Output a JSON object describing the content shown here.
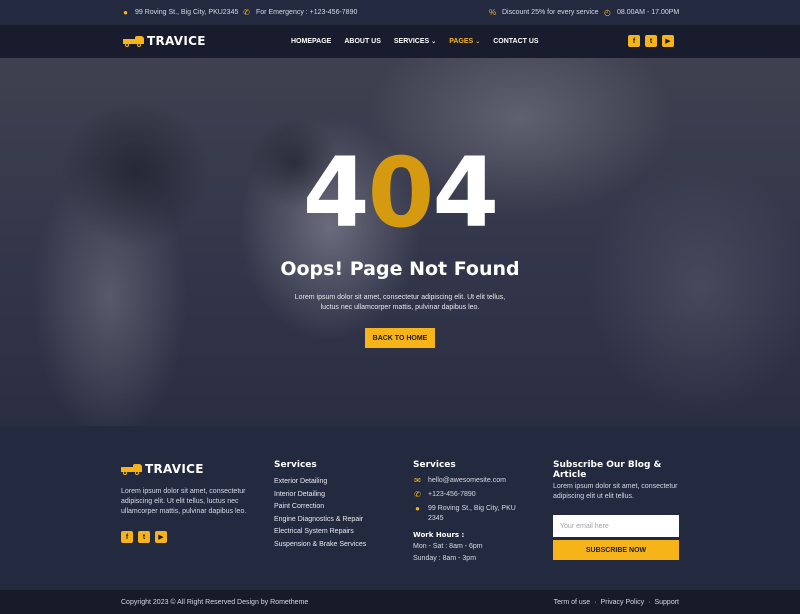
{
  "topbar": {
    "address": "99 Roving St., Big City, PKU2345",
    "emergency": "For Emergency : +123-456-7890",
    "discount": "Discount 25% for every service",
    "hours": "08.00AM - 17.00PM"
  },
  "brand": {
    "name": "TRAVICE",
    "accent": "#f6b418"
  },
  "nav": {
    "items": [
      {
        "label": "HOMEPAGE"
      },
      {
        "label": "ABOUT US"
      },
      {
        "label": "SERVICES"
      },
      {
        "label": "PAGES"
      },
      {
        "label": "CONTACT US"
      }
    ],
    "socials": [
      "facebook-icon",
      "twitter-icon",
      "youtube-icon"
    ]
  },
  "hero": {
    "code_left": "4",
    "code_mid": "0",
    "code_right": "4",
    "title": "Oops! Page Not Found",
    "text": "Lorem ipsum dolor sit amet, consectetur adipiscing elit. Ut elit tellus, luctus nec ullamcorper mattis, pulvinar dapibus leo.",
    "button": "BACK TO HOME"
  },
  "footer": {
    "about": "Lorem ipsum dolor sit amet, consectetur adipiscing elit. Ut elit tellus, luctus nec ullamcorper mattis, pulvinar dapibus leo.",
    "services_heading": "Services",
    "services": [
      "Exterior Detailing",
      "Interior Detailing",
      "Paint Correction",
      "Engine Diagnostics & Repair",
      "Electrical System Repairs",
      "Suspension & Brake Services"
    ],
    "contact_heading": "Services",
    "email": "hello@awesomesite.com",
    "phone": "+123-456-7890",
    "address": "99 Roving St., Big City, PKU 2345",
    "work_hours_heading": "Work Hours :",
    "hours_weekday": "Mon - Sat : 8am - 6pm",
    "hours_sunday": "Sunday : 8am - 3pm",
    "subscribe_heading": "Subscribe Our Blog & Article",
    "subscribe_text": "Lorem ipsum dolor sit amet, consectetur adipiscing elit ut elit tellus.",
    "email_placeholder": "Your email here",
    "subscribe_button": "SUBSCRIBE NOW"
  },
  "bottom": {
    "copyright": "Copyright 2023 © All Right Reserved Design by Rometheme",
    "links": [
      "Term of use",
      "Privacy Policy",
      "Support"
    ],
    "separator": "·"
  }
}
